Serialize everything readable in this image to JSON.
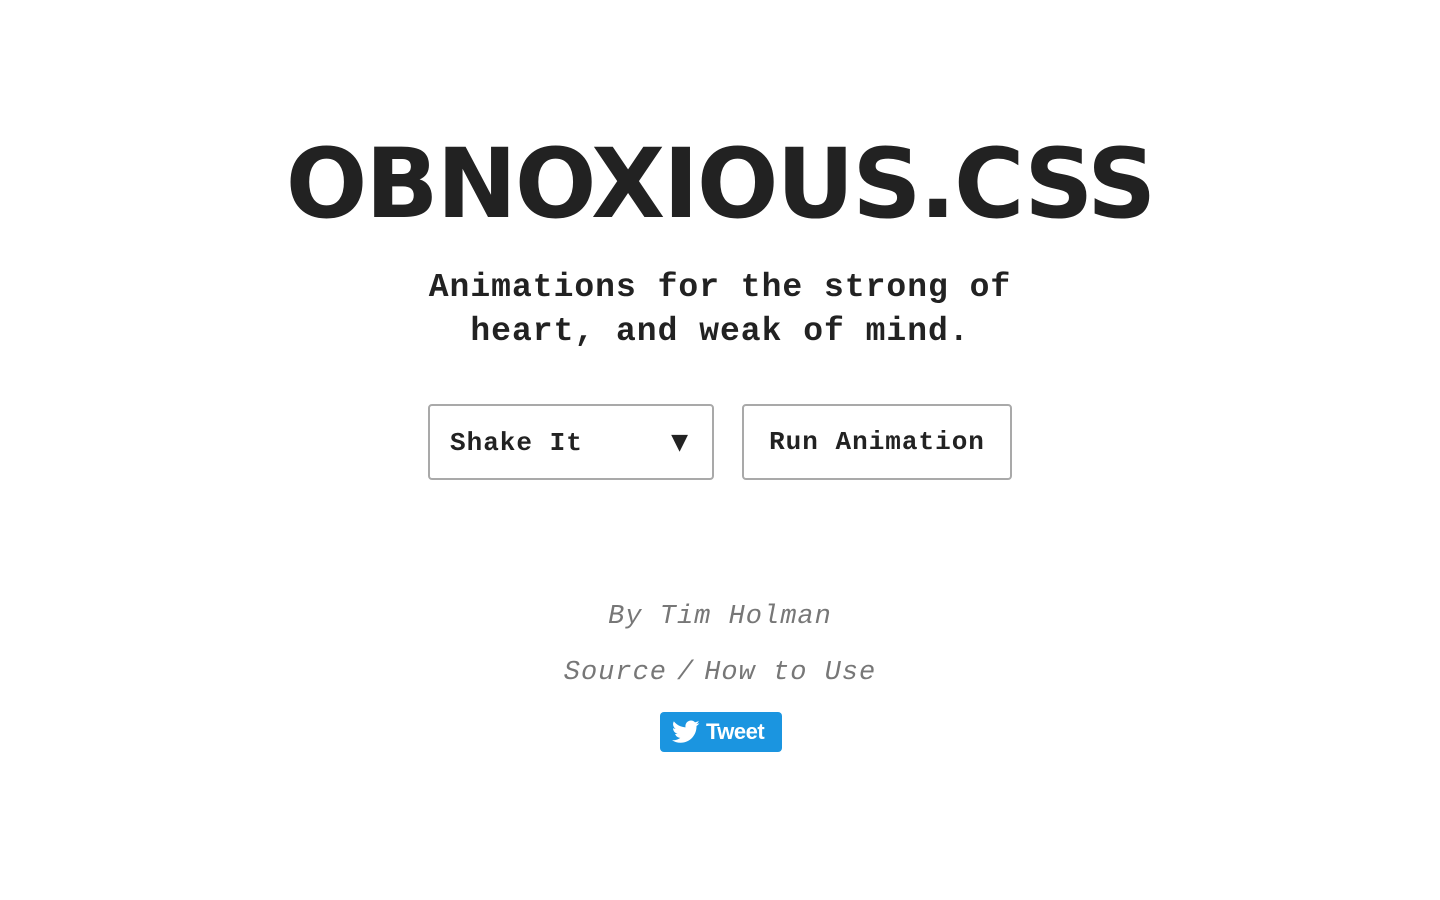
{
  "header": {
    "title": "OBNOXIOUS.CSS",
    "subtitle_line1": "Animations for the strong of",
    "subtitle_line2": "heart, and weak of mind."
  },
  "controls": {
    "animation_select": {
      "selected": "Shake It",
      "arrow": "▼"
    },
    "run_button_label": "Run Animation"
  },
  "footer": {
    "byline": "By Tim Holman",
    "source_link": "Source",
    "separator": "/",
    "how_to_link": "How to Use",
    "tweet_label": "Tweet",
    "tweet_icon": "twitter-bird-icon",
    "tweet_color": "#1b95e0"
  }
}
